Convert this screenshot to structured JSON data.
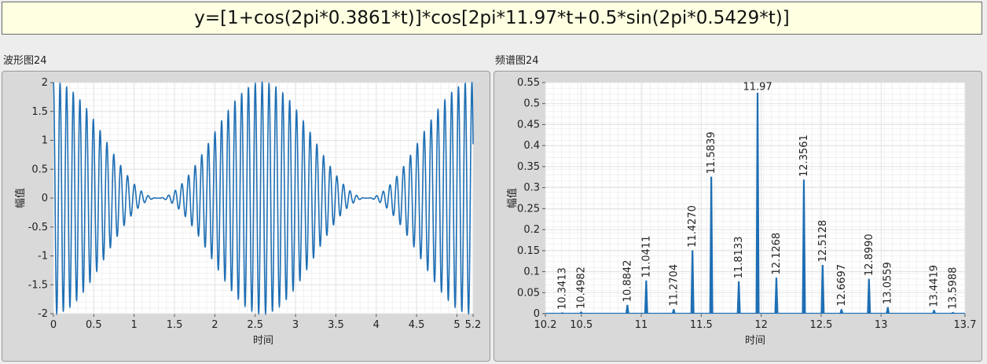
{
  "formula": "y=[1+cos(2pi*0.3861*t)]*cos[2pi*11.97*t+0.5*sin(2pi*0.5429*t)]",
  "left_label": "波形图24",
  "right_label": "频谱图24",
  "colors": {
    "trace": "#1f6fb4",
    "grid": "#e3e3e3",
    "plot_bg": "#ffffff",
    "formula_bg": "#ffffe1"
  },
  "chart_data": [
    {
      "type": "line",
      "title": "波形图24",
      "xlabel": "时间",
      "ylabel": "幅值",
      "xlim": [
        0,
        5.2
      ],
      "ylim": [
        -2,
        2
      ],
      "x_ticks": [
        "0",
        "0.5",
        "1",
        "1.5",
        "2",
        "2.5",
        "3",
        "3.5",
        "4",
        "4.5",
        "5",
        "5.2"
      ],
      "y_ticks": [
        "2",
        "1.5",
        "1",
        "0.5",
        "0",
        "-0.5",
        "-1",
        "-1.5",
        "-2"
      ],
      "grid": true,
      "series": [
        {
          "carrier_hz": 11.97,
          "am_hz": 0.3861,
          "fm_index": 0.5,
          "fm_hz": 0.5429
        }
      ]
    },
    {
      "type": "line",
      "title": "频谱图24",
      "xlabel": "时间",
      "ylabel": "幅值",
      "xlim": [
        10.2,
        13.7
      ],
      "ylim": [
        0,
        0.55
      ],
      "x_ticks": [
        "10.2",
        "10.5",
        "11",
        "11.5",
        "12",
        "12.5",
        "13",
        "13.7"
      ],
      "y_ticks": [
        "0.55",
        "0.5",
        "0.45",
        "0.4",
        "0.35",
        "0.3",
        "0.25",
        "0.2",
        "0.15",
        "0.1",
        "0.05",
        "0"
      ],
      "grid": true,
      "peaks": [
        {
          "x": 10.3413,
          "y": 0.002,
          "label": "10.3413"
        },
        {
          "x": 10.4982,
          "y": 0.004,
          "label": "10.4982"
        },
        {
          "x": 10.8842,
          "y": 0.02,
          "label": "10.8842"
        },
        {
          "x": 11.0411,
          "y": 0.078,
          "label": "11.0411"
        },
        {
          "x": 11.2704,
          "y": 0.01,
          "label": "11.2704"
        },
        {
          "x": 11.427,
          "y": 0.15,
          "label": "11.4270"
        },
        {
          "x": 11.5839,
          "y": 0.325,
          "label": "11.5839"
        },
        {
          "x": 11.8133,
          "y": 0.076,
          "label": "11.8133"
        },
        {
          "x": 11.97,
          "y": 0.525,
          "label": "11.97"
        },
        {
          "x": 12.1268,
          "y": 0.085,
          "label": "12.1268"
        },
        {
          "x": 12.3561,
          "y": 0.318,
          "label": "12.3561"
        },
        {
          "x": 12.5128,
          "y": 0.115,
          "label": "12.5128"
        },
        {
          "x": 12.6697,
          "y": 0.01,
          "label": "12.6697"
        },
        {
          "x": 12.899,
          "y": 0.082,
          "label": "12.8990"
        },
        {
          "x": 13.0559,
          "y": 0.015,
          "label": "13.0559"
        },
        {
          "x": 13.4419,
          "y": 0.008,
          "label": "13.4419"
        },
        {
          "x": 13.5988,
          "y": 0.003,
          "label": "13.5988"
        }
      ]
    }
  ]
}
